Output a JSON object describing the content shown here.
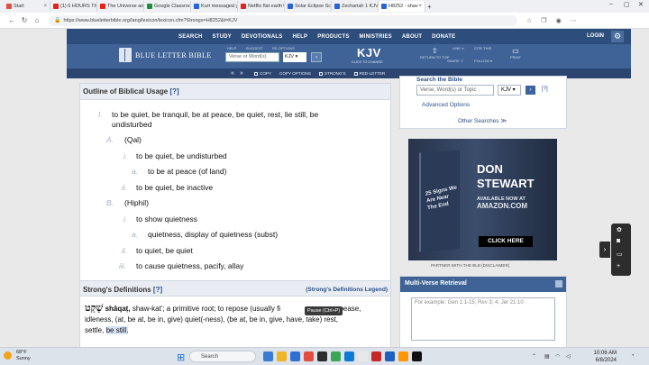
{
  "browser": {
    "tabs": [
      {
        "label": "Start",
        "color": "#e34d3f"
      },
      {
        "label": "(1) 6 HOURS The",
        "color": "#e62117"
      },
      {
        "label": "The Universe an",
        "color": "#e62117"
      },
      {
        "label": "Google Classroo",
        "color": "#1e8e3e"
      },
      {
        "label": "Kurt messaged y",
        "color": "#2a63d5"
      },
      {
        "label": "Netflix flat earth",
        "color": "#e62117"
      },
      {
        "label": "Solar Eclipse Scie",
        "color": "#2a63d5"
      },
      {
        "label": "Zechariah 1 KJV",
        "color": "#2a63d5"
      },
      {
        "label": "H8252 - shav",
        "color": "#2a63d5"
      }
    ],
    "url": "https://www.blueletterbible.org/lang/lexicon/lexicon.cfm?Strongs=H8252&t=KJV"
  },
  "site": {
    "nav": [
      "SEARCH",
      "STUDY",
      "DEVOTIONALS",
      "HELP",
      "PRODUCTS",
      "MINISTRIES",
      "ABOUT",
      "DONATE"
    ],
    "login": "LOGIN",
    "logo_text": "BLUE LETTER BIBLE",
    "header_labels": [
      "HELP",
      "SUGGEST",
      "RE-OPTIONS"
    ],
    "search_placeholder": "Verse or Word(s)",
    "version": "KJV",
    "version_big": "KJV",
    "version_sub": "CLICK TO CHANGE",
    "tools": [
      "RETURN TO TOP",
      "LINK",
      "CITE THIS",
      "SHARE",
      "FOLLOW",
      "PRINT"
    ],
    "toolbar": [
      "COPY",
      "COPY OPTIONS",
      "STRONG'S",
      "RED-LETTER"
    ]
  },
  "outline": {
    "heading": "Outline of Biblical Usage",
    "help": "[?]",
    "items": [
      {
        "num": "I.",
        "text": "to be quiet, be tranquil, be at peace, be quiet, rest, lie still, be"
      },
      {
        "num": "",
        "text": "undisturbed"
      },
      {
        "num": "A.",
        "text": "(Qal)"
      },
      {
        "num": "i.",
        "text": "to be quiet, be undisturbed"
      },
      {
        "num": "a.",
        "text": "to be at peace (of land)"
      },
      {
        "num": "ii.",
        "text": "to be quiet, be inactive"
      },
      {
        "num": "B.",
        "text": "(Hiphil)"
      },
      {
        "num": "i.",
        "text": "to show quietness"
      },
      {
        "num": "a.",
        "text": "quietness, display of quietness (subst)"
      },
      {
        "num": "ii.",
        "text": "to quiet, be quiet"
      },
      {
        "num": "iii.",
        "text": "to cause quietness, pacify, allay"
      }
    ]
  },
  "strongs": {
    "heading": "Strong's Definitions",
    "help": "[?]",
    "legend": "(Strong's Definitions Legend)",
    "hebrew": "שָׁקַט",
    "translit": "shâqaṭ,",
    "line1": "shaw-kat'; a primitive root; to repose (usually fi",
    "line1b": "appease,",
    "line2": "idleness, (at, be at, be in, give) quiet(-ness), (be at, be in, give, have, take) rest,",
    "line3": "settle,",
    "highlight": "be still."
  },
  "tooltip": "Pause (Ctrl+P)",
  "right": {
    "search_title": "Search the Bible",
    "search_placeholder": "Verse, Word(s) or Topic",
    "version": "KJV",
    "help": "[?]",
    "advanced": "Advanced Options",
    "other": "Other Searches ≫"
  },
  "ad": {
    "book_title": "25 Signs We Are Near The End",
    "author_line1": "DON",
    "author_line2": "STEWART",
    "available_line1": "AVAILABLE NOW AT",
    "available_line2": "AMAZON.COM",
    "cta": "CLICK HERE",
    "partner": "PARTNER WITH THE BLB   (DISCLAIMER)"
  },
  "multiverse": {
    "heading": "Multi-Verse Retrieval",
    "placeholder": "For example: Gen 1:1-15; Rev 3; 4; Jer 21:10"
  },
  "taskbar": {
    "temp": "68°F",
    "condition": "Sunny",
    "search": "Search",
    "time": "10:06 AM",
    "date": "6/8/2024"
  }
}
